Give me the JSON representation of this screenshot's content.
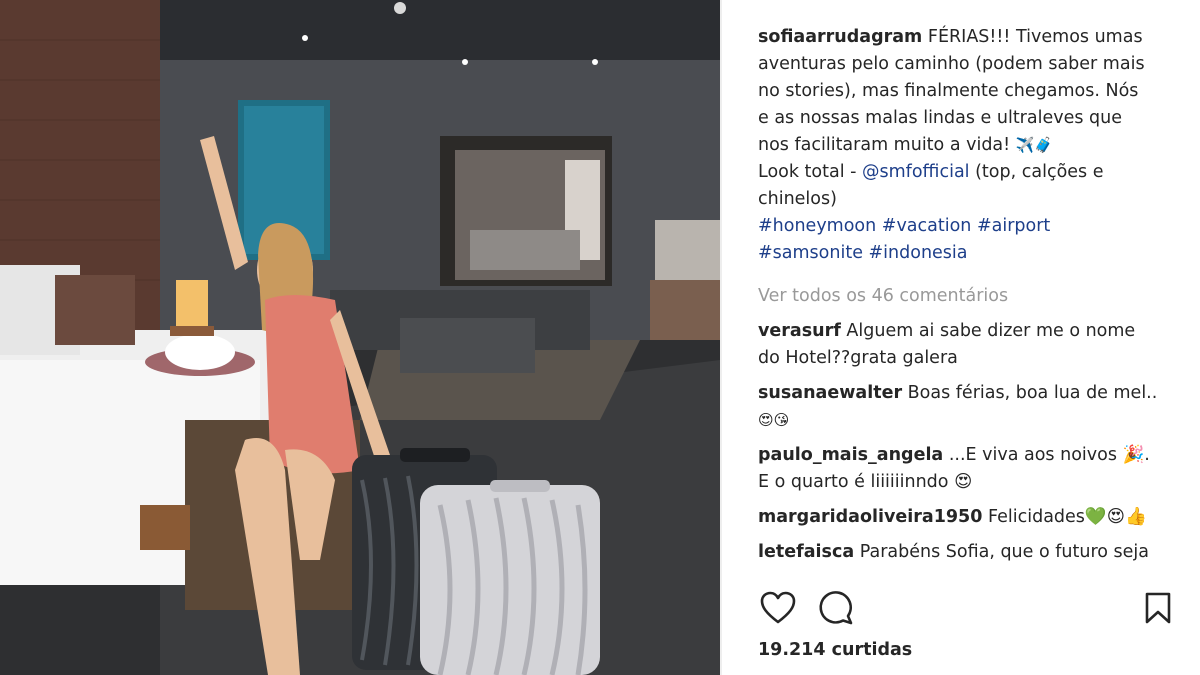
{
  "caption": {
    "username": "sofiaarrudagram",
    "line1": "FÉRIAS!!! Tivemos umas",
    "line2": "aventuras pelo caminho (podem saber mais",
    "line3": "no stories), mas finalmente chegamos. Nós",
    "line4": "e as nossas malas lindas e ultraleves que",
    "line5": "nos facilitaram muito a vida!",
    "line5_emoji": "✈️🧳",
    "line6_text": "Look total - ",
    "line6_mention": "@smfofficial",
    "line6_rest": " (top, calções e",
    "line7": "chinelos)",
    "hashtags_line1": "#honeymoon #vacation #airport",
    "hashtags_line2": "#samsonite #indonesia"
  },
  "view_all_comments": "Ver todos os 46 comentários",
  "comments": [
    {
      "username": "verasurf",
      "line1": "Alguem ai sabe dizer me o nome",
      "line2": "do Hotel??grata galera"
    },
    {
      "username": "susanaewalter",
      "line1": "Boas férias, boa lua de mel...",
      "line2": "😍😘"
    },
    {
      "username": "paulo_mais_angela",
      "line1": "...E viva aos noivos 🎉.",
      "line2": "E o quarto é liiiiiinndo 😍"
    },
    {
      "username": "margaridaoliveira1950",
      "line1": "Felicidades💚😍👍"
    },
    {
      "username": "letefaisca",
      "line1": "Parabéns Sofia, que o futuro seja"
    }
  ],
  "actions": {
    "like_icon": "heart-icon",
    "comment_icon": "comment-bubble-icon",
    "save_icon": "bookmark-icon"
  },
  "likes": "19.214 curtidas",
  "colors": {
    "hashtag": "#1e3f8a",
    "muted": "#999999",
    "text": "#262626"
  }
}
